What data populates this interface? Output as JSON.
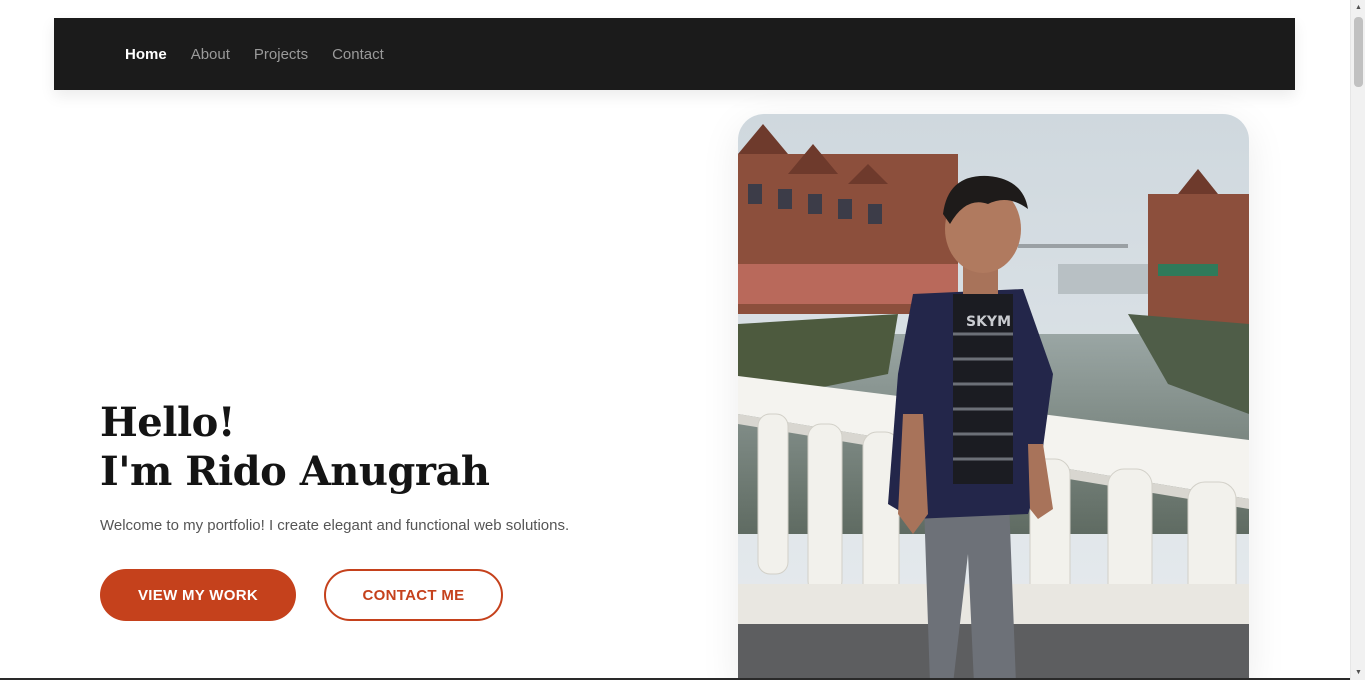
{
  "nav": {
    "items": [
      {
        "label": "Home",
        "active": true
      },
      {
        "label": "About",
        "active": false
      },
      {
        "label": "Projects",
        "active": false
      },
      {
        "label": "Contact",
        "active": false
      }
    ]
  },
  "hero": {
    "greeting": "Hello!",
    "name_line": "I'm Rido Anugrah",
    "subtitle": "Welcome to my portfolio! I create elegant and functional web solutions.",
    "primary_button": "VIEW MY WORK",
    "secondary_button": "CONTACT ME"
  },
  "photo": {
    "shirt_text": "SKYM"
  },
  "colors": {
    "accent": "#c5411c",
    "navbar": "#1b1b1b"
  }
}
